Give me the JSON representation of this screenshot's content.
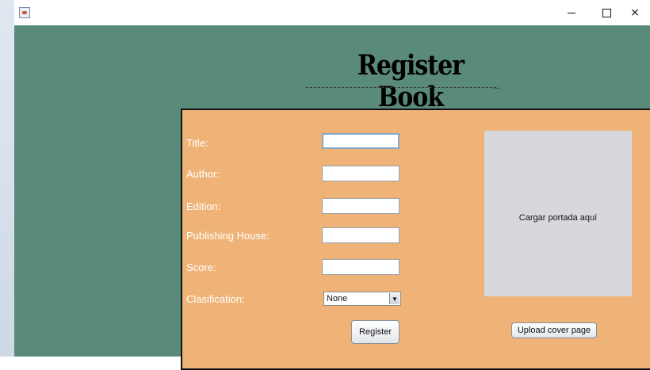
{
  "window": {
    "title": "",
    "controls": {
      "minimize": "minimize-icon",
      "maximize": "maximize-icon",
      "close": "×"
    }
  },
  "heading": "Register Book",
  "form": {
    "labels": {
      "title": "Title:",
      "author": "Author:",
      "edition": "Edition:",
      "publishing_house": "Publishing House:",
      "score": "Score:",
      "clasification": "Clasification:"
    },
    "values": {
      "title": "",
      "author": "",
      "edition": "",
      "publishing_house": "",
      "score": ""
    },
    "clasification_selected": "None",
    "register_button": "Register"
  },
  "cover": {
    "placeholder": "Cargar portada aquí",
    "upload_button": "Upload cover page"
  },
  "colors": {
    "background": "#5a8a7a",
    "panel": "#efb378",
    "drop_zone": "#d6d8de"
  }
}
